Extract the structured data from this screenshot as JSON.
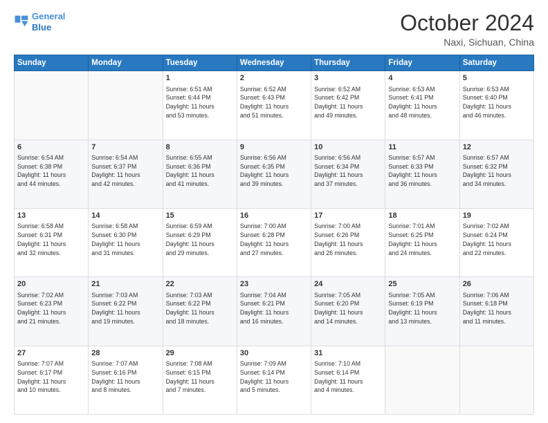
{
  "logo": {
    "line1": "General",
    "line2": "Blue"
  },
  "header": {
    "month": "October 2024",
    "location": "Naxi, Sichuan, China"
  },
  "weekdays": [
    "Sunday",
    "Monday",
    "Tuesday",
    "Wednesday",
    "Thursday",
    "Friday",
    "Saturday"
  ],
  "weeks": [
    [
      {
        "day": "",
        "text": ""
      },
      {
        "day": "",
        "text": ""
      },
      {
        "day": "1",
        "text": "Sunrise: 6:51 AM\nSunset: 6:44 PM\nDaylight: 11 hours\nand 53 minutes."
      },
      {
        "day": "2",
        "text": "Sunrise: 6:52 AM\nSunset: 6:43 PM\nDaylight: 11 hours\nand 51 minutes."
      },
      {
        "day": "3",
        "text": "Sunrise: 6:52 AM\nSunset: 6:42 PM\nDaylight: 11 hours\nand 49 minutes."
      },
      {
        "day": "4",
        "text": "Sunrise: 6:53 AM\nSunset: 6:41 PM\nDaylight: 11 hours\nand 48 minutes."
      },
      {
        "day": "5",
        "text": "Sunrise: 6:53 AM\nSunset: 6:40 PM\nDaylight: 11 hours\nand 46 minutes."
      }
    ],
    [
      {
        "day": "6",
        "text": "Sunrise: 6:54 AM\nSunset: 6:38 PM\nDaylight: 11 hours\nand 44 minutes."
      },
      {
        "day": "7",
        "text": "Sunrise: 6:54 AM\nSunset: 6:37 PM\nDaylight: 11 hours\nand 42 minutes."
      },
      {
        "day": "8",
        "text": "Sunrise: 6:55 AM\nSunset: 6:36 PM\nDaylight: 11 hours\nand 41 minutes."
      },
      {
        "day": "9",
        "text": "Sunrise: 6:56 AM\nSunset: 6:35 PM\nDaylight: 11 hours\nand 39 minutes."
      },
      {
        "day": "10",
        "text": "Sunrise: 6:56 AM\nSunset: 6:34 PM\nDaylight: 11 hours\nand 37 minutes."
      },
      {
        "day": "11",
        "text": "Sunrise: 6:57 AM\nSunset: 6:33 PM\nDaylight: 11 hours\nand 36 minutes."
      },
      {
        "day": "12",
        "text": "Sunrise: 6:57 AM\nSunset: 6:32 PM\nDaylight: 11 hours\nand 34 minutes."
      }
    ],
    [
      {
        "day": "13",
        "text": "Sunrise: 6:58 AM\nSunset: 6:31 PM\nDaylight: 11 hours\nand 32 minutes."
      },
      {
        "day": "14",
        "text": "Sunrise: 6:58 AM\nSunset: 6:30 PM\nDaylight: 11 hours\nand 31 minutes."
      },
      {
        "day": "15",
        "text": "Sunrise: 6:59 AM\nSunset: 6:29 PM\nDaylight: 11 hours\nand 29 minutes."
      },
      {
        "day": "16",
        "text": "Sunrise: 7:00 AM\nSunset: 6:28 PM\nDaylight: 11 hours\nand 27 minutes."
      },
      {
        "day": "17",
        "text": "Sunrise: 7:00 AM\nSunset: 6:26 PM\nDaylight: 11 hours\nand 26 minutes."
      },
      {
        "day": "18",
        "text": "Sunrise: 7:01 AM\nSunset: 6:25 PM\nDaylight: 11 hours\nand 24 minutes."
      },
      {
        "day": "19",
        "text": "Sunrise: 7:02 AM\nSunset: 6:24 PM\nDaylight: 11 hours\nand 22 minutes."
      }
    ],
    [
      {
        "day": "20",
        "text": "Sunrise: 7:02 AM\nSunset: 6:23 PM\nDaylight: 11 hours\nand 21 minutes."
      },
      {
        "day": "21",
        "text": "Sunrise: 7:03 AM\nSunset: 6:22 PM\nDaylight: 11 hours\nand 19 minutes."
      },
      {
        "day": "22",
        "text": "Sunrise: 7:03 AM\nSunset: 6:22 PM\nDaylight: 11 hours\nand 18 minutes."
      },
      {
        "day": "23",
        "text": "Sunrise: 7:04 AM\nSunset: 6:21 PM\nDaylight: 11 hours\nand 16 minutes."
      },
      {
        "day": "24",
        "text": "Sunrise: 7:05 AM\nSunset: 6:20 PM\nDaylight: 11 hours\nand 14 minutes."
      },
      {
        "day": "25",
        "text": "Sunrise: 7:05 AM\nSunset: 6:19 PM\nDaylight: 11 hours\nand 13 minutes."
      },
      {
        "day": "26",
        "text": "Sunrise: 7:06 AM\nSunset: 6:18 PM\nDaylight: 11 hours\nand 11 minutes."
      }
    ],
    [
      {
        "day": "27",
        "text": "Sunrise: 7:07 AM\nSunset: 6:17 PM\nDaylight: 11 hours\nand 10 minutes."
      },
      {
        "day": "28",
        "text": "Sunrise: 7:07 AM\nSunset: 6:16 PM\nDaylight: 11 hours\nand 8 minutes."
      },
      {
        "day": "29",
        "text": "Sunrise: 7:08 AM\nSunset: 6:15 PM\nDaylight: 11 hours\nand 7 minutes."
      },
      {
        "day": "30",
        "text": "Sunrise: 7:09 AM\nSunset: 6:14 PM\nDaylight: 11 hours\nand 5 minutes."
      },
      {
        "day": "31",
        "text": "Sunrise: 7:10 AM\nSunset: 6:14 PM\nDaylight: 11 hours\nand 4 minutes."
      },
      {
        "day": "",
        "text": ""
      },
      {
        "day": "",
        "text": ""
      }
    ]
  ]
}
